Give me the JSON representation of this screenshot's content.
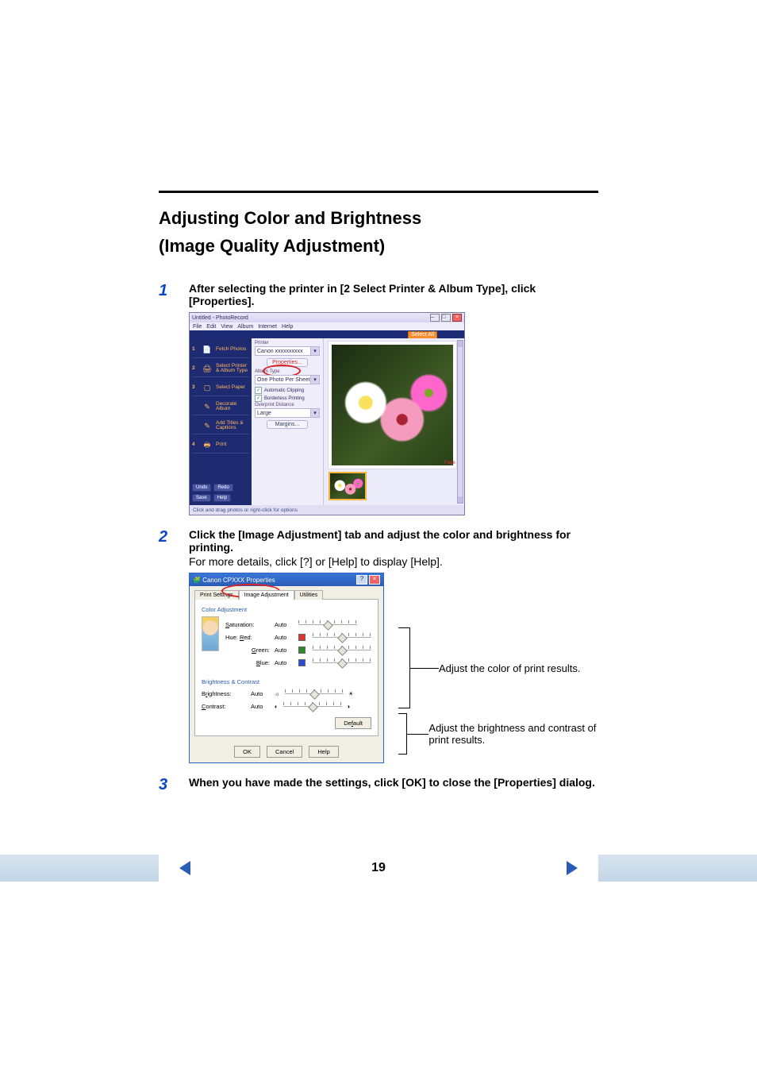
{
  "heading": {
    "line1": "Adjusting Color and Brightness",
    "line2": " (Image Quality Adjustment)"
  },
  "steps": {
    "s1": {
      "num": "1",
      "bold": "After selecting the printer in [2 Select Printer & Album Type], click [Properties]."
    },
    "s2": {
      "num": "2",
      "bold": "Click the [Image Adjustment] tab and adjust the color and brightness for printing.",
      "sub": "For more details, click [?] or [Help] to display [Help]."
    },
    "s3": {
      "num": "3",
      "bold": "When you have made the settings, click [OK] to close the [Properties] dialog."
    }
  },
  "shot1": {
    "title": "Untitled - PhotoRecord",
    "menu": [
      "File",
      "Edit",
      "View",
      "Album",
      "Internet",
      "Help"
    ],
    "select_all": "Select All",
    "side": {
      "i1": {
        "idx": "1",
        "label": "Fetch Photos"
      },
      "i2": {
        "idx": "2",
        "label": "Select Printer & Album Type"
      },
      "i3": {
        "idx": "3",
        "label": "Select Paper"
      },
      "i4": {
        "idx": "",
        "label": "Decorate Album"
      },
      "i5": {
        "idx": "",
        "label": "Add Titles & Captions"
      },
      "i6": {
        "idx": "4",
        "label": "Print"
      }
    },
    "sfoot": {
      "undo": "Undo",
      "redo": "Redo",
      "save": "Save",
      "help": "Help"
    },
    "center": {
      "printer_lbl": "Printer",
      "printer_val": "Canon xxxxxxxxxx",
      "properties": "Properties...",
      "album_lbl": "Album Type",
      "album_val": "One Photo Per Sheet",
      "clip": "Automatic Clipping",
      "borderless": "Borderless Printing",
      "overprint": "Overprint Distance",
      "overprint_val": "Large",
      "margins": "Margins..."
    },
    "pagei": "Page 1",
    "status": "Click and drag photos or right-click for options"
  },
  "shot2": {
    "title": "Canon CPXXX Properties",
    "tabs": {
      "t1": "Print Settings",
      "t2": "Image Adjustment",
      "t3": "Utilities"
    },
    "g1": "Color Adjustment",
    "g2": "Brightness & Contrast",
    "rows": {
      "sat": "Saturation:",
      "hue": "Hue: Red:",
      "green": "Green:",
      "blue": "Blue:",
      "brightness": "Brightness:",
      "contrast": "Contrast:"
    },
    "auto": "Auto",
    "default": "Default",
    "ok": "OK",
    "cancel": "Cancel",
    "help": "Help"
  },
  "callout": {
    "c1": "Adjust the color of print results.",
    "c2": "Adjust the brightness and contrast of print results."
  },
  "page_number": "19"
}
